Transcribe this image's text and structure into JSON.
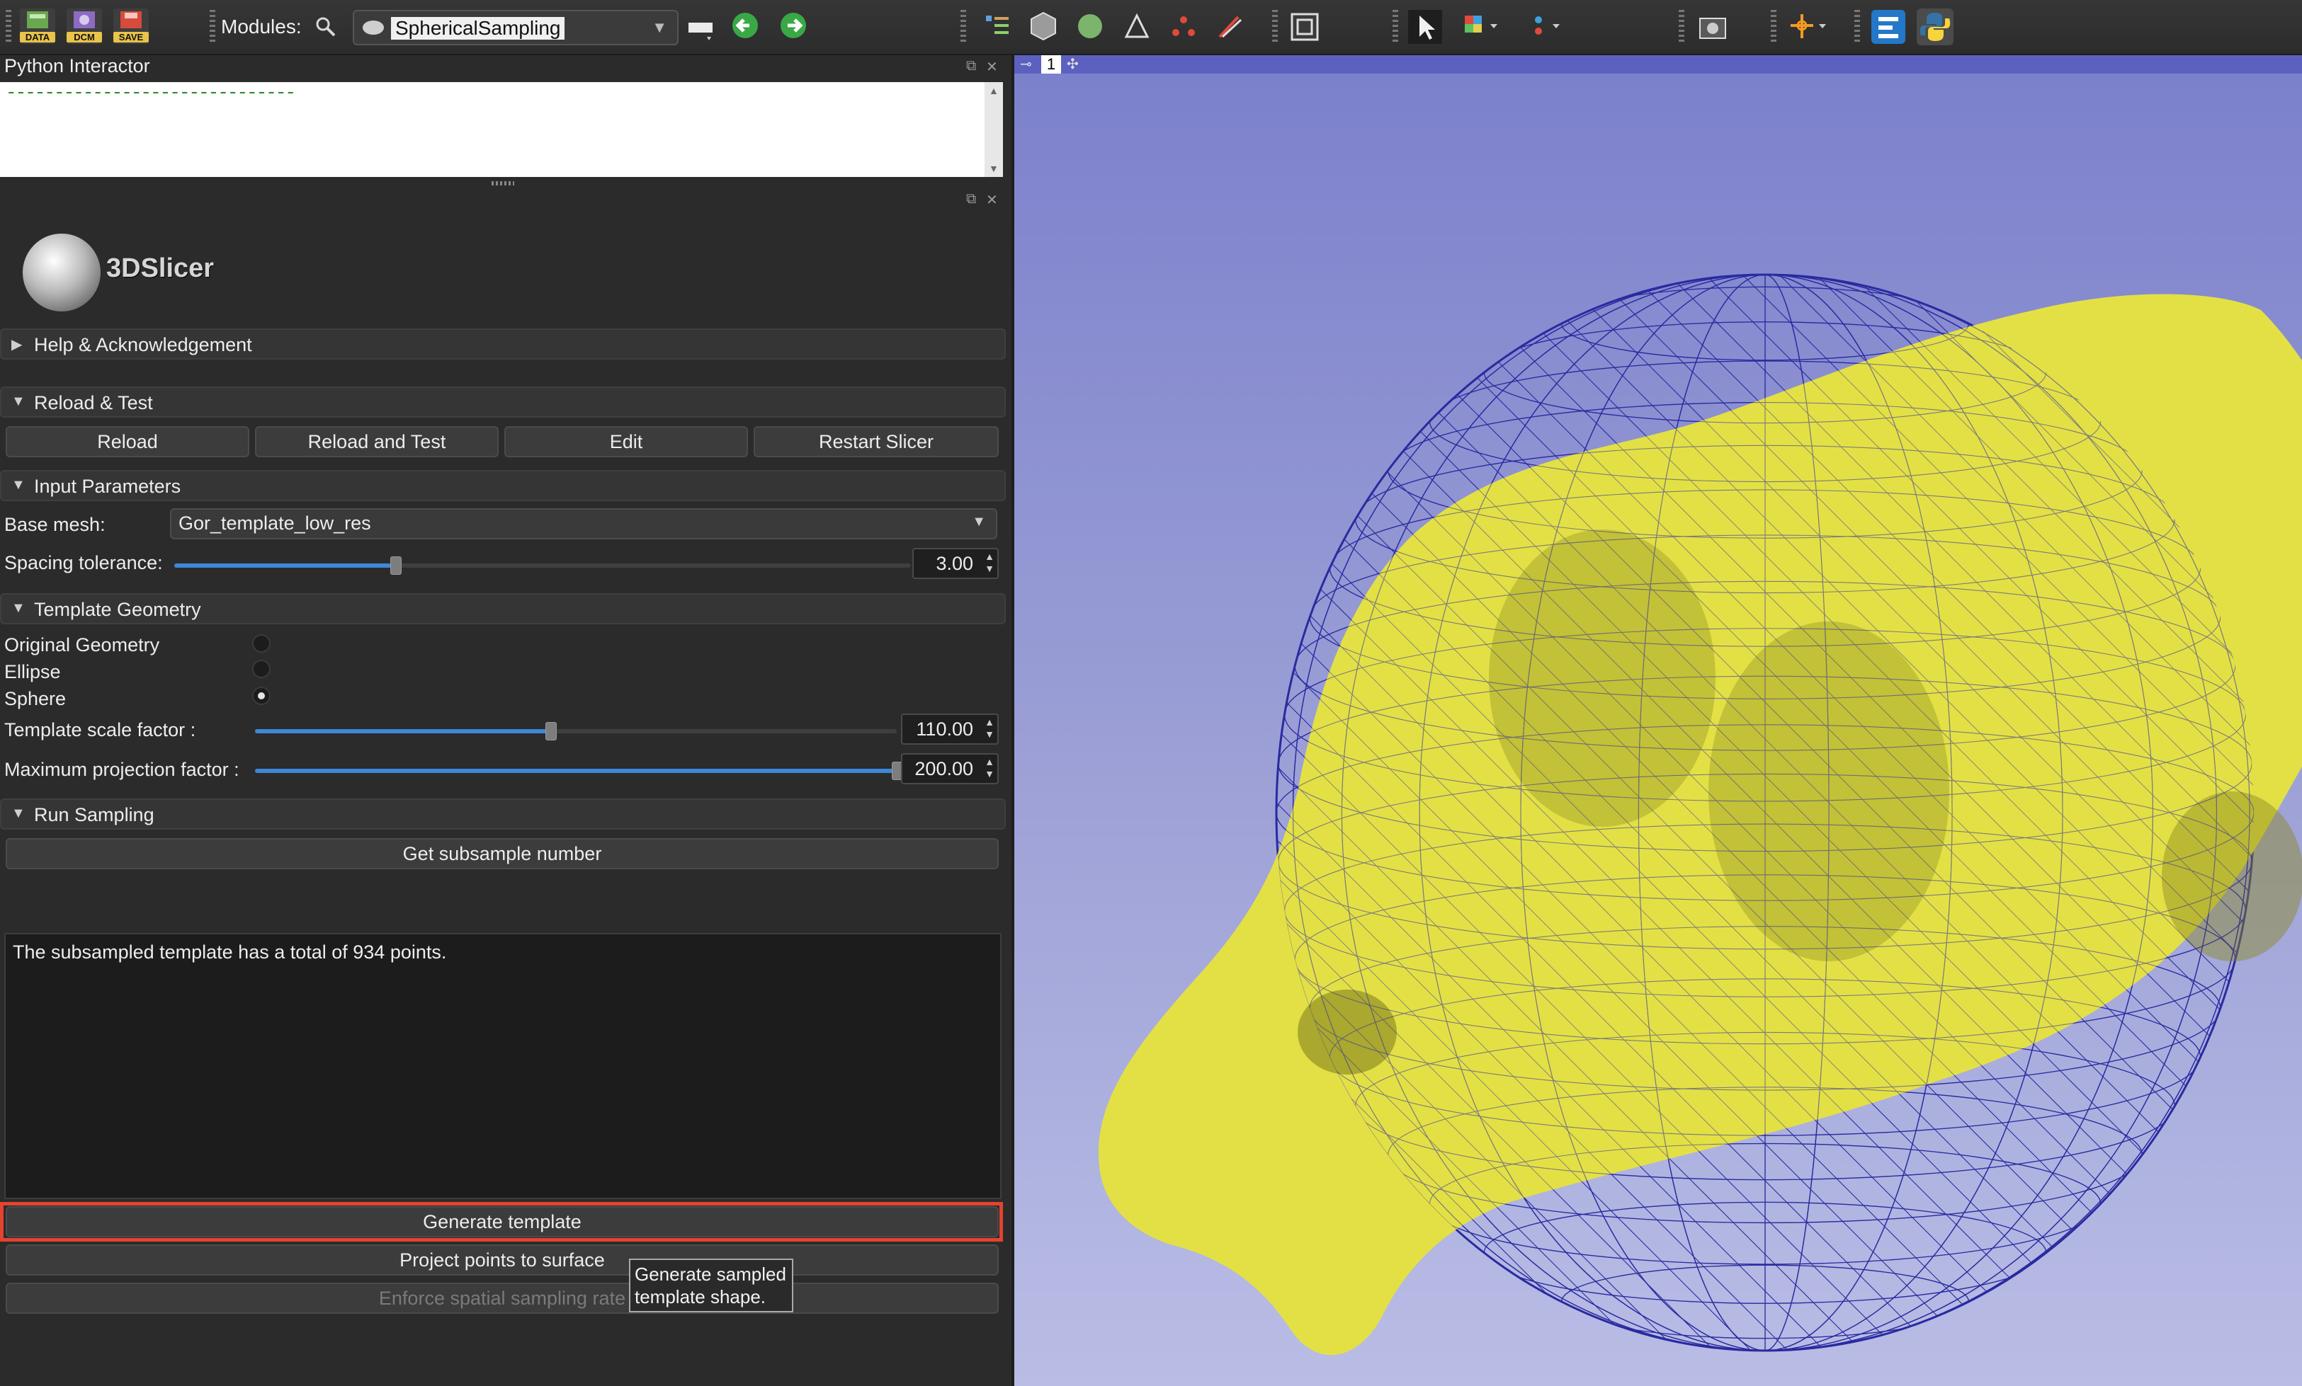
{
  "toolbar": {
    "data_label": "DATA",
    "dcm_label": "DCM",
    "save_label": "SAVE",
    "modules_label": "Modules:",
    "module_selected": "SphericalSampling"
  },
  "python_interactor": {
    "title": "Python Interactor",
    "content": "------------------------------"
  },
  "module_header": {
    "app_name": "3DSlicer"
  },
  "sections": {
    "help": "Help & Acknowledgement",
    "reload_test": "Reload & Test",
    "input_params": "Input Parameters",
    "template_geometry": "Template Geometry",
    "run_sampling": "Run Sampling"
  },
  "reload_buttons": [
    "Reload",
    "Reload and Test",
    "Edit",
    "Restart Slicer"
  ],
  "input": {
    "base_mesh_label": "Base mesh:",
    "base_mesh_value": "Gor_template_low_res",
    "spacing_label": "Spacing tolerance:",
    "spacing_value": "3.00",
    "spacing_fraction": 0.3
  },
  "geometry": {
    "options": [
      "Original Geometry",
      "Ellipse",
      "Sphere"
    ],
    "selected": "Sphere",
    "scale_label": "Template scale factor :",
    "scale_value": "110.00",
    "scale_fraction": 0.46,
    "proj_label": "Maximum projection factor :",
    "proj_value": "200.00",
    "proj_fraction": 1.0
  },
  "run": {
    "subsample_button": "Get subsample number",
    "output_text": "The subsampled template has a total of 934 points.",
    "generate_button": "Generate template",
    "project_button": "Project points to surface",
    "enforce_button": "Enforce spatial sampling rate",
    "tooltip": "Generate sampled template shape."
  },
  "view3d": {
    "view_number": "1",
    "wire_color": "#2a2aa0",
    "mesh_color": "#e3e046"
  },
  "colors": {
    "highlight": "#e5432e",
    "slider_fill": "#3d88d8"
  }
}
